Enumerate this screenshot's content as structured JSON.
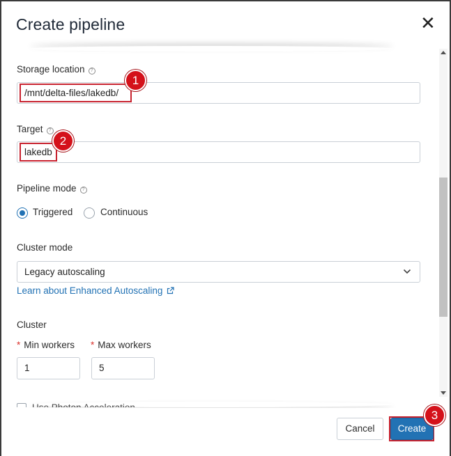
{
  "dialog": {
    "title": "Create pipeline",
    "close_symbol": "✕"
  },
  "form": {
    "storage_location": {
      "label": "Storage location",
      "value": "/mnt/delta-files/lakedb/"
    },
    "target": {
      "label": "Target",
      "value": "lakedb"
    },
    "pipeline_mode": {
      "label": "Pipeline mode",
      "options": [
        {
          "label": "Triggered",
          "selected": true
        },
        {
          "label": "Continuous",
          "selected": false
        }
      ]
    },
    "cluster_mode": {
      "label": "Cluster mode",
      "selected": "Legacy autoscaling",
      "link_text": "Learn about Enhanced Autoscaling"
    },
    "cluster": {
      "label": "Cluster",
      "min_workers": {
        "label": "Min workers",
        "value": "1"
      },
      "max_workers": {
        "label": "Max workers",
        "value": "5"
      }
    },
    "partially_hidden_option": "Use Photon Acceleration"
  },
  "footer": {
    "cancel_label": "Cancel",
    "create_label": "Create"
  },
  "annotations": {
    "badge_1": "1",
    "badge_2": "2",
    "badge_3": "3"
  },
  "colors": {
    "accent": "#2272b4",
    "highlight": "#c8222f",
    "badge": "#d4111a",
    "required": "#d9312b"
  },
  "icons": {
    "help": "help-circle-icon",
    "close": "close-icon",
    "dropdown": "chevron-down-icon",
    "external_link": "external-link-icon",
    "scroll_up": "scroll-up-arrow-icon",
    "scroll_down": "scroll-down-arrow-icon"
  }
}
